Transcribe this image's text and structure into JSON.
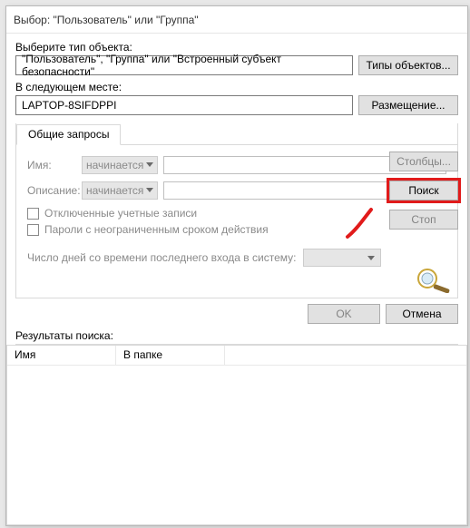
{
  "window": {
    "title": "Выбор: \"Пользователь\" или \"Группа\""
  },
  "objectType": {
    "label": "Выберите тип объекта:",
    "value": "\"Пользователь\", \"Группа\" или \"Встроенный субъект безопасности\"",
    "button": "Типы объектов..."
  },
  "location": {
    "label": "В следующем месте:",
    "value": "LAPTOP-8SIFDPPI",
    "button": "Размещение..."
  },
  "tabs": {
    "common": "Общие запросы"
  },
  "form": {
    "nameLabel": "Имя:",
    "descLabel": "Описание:",
    "startsWith": "начинается с",
    "disabledAccounts": "Отключенные учетные записи",
    "nonExpiringPw": "Пароли с неограниченным сроком действия",
    "lastLogin": "Число дней со времени последнего входа в систему:"
  },
  "buttons": {
    "columns": "Столбцы...",
    "search": "Поиск",
    "stop": "Стоп",
    "ok": "OK",
    "cancel": "Отмена"
  },
  "results": {
    "label": "Результаты поиска:",
    "col1": "Имя",
    "col2": "В папке"
  }
}
